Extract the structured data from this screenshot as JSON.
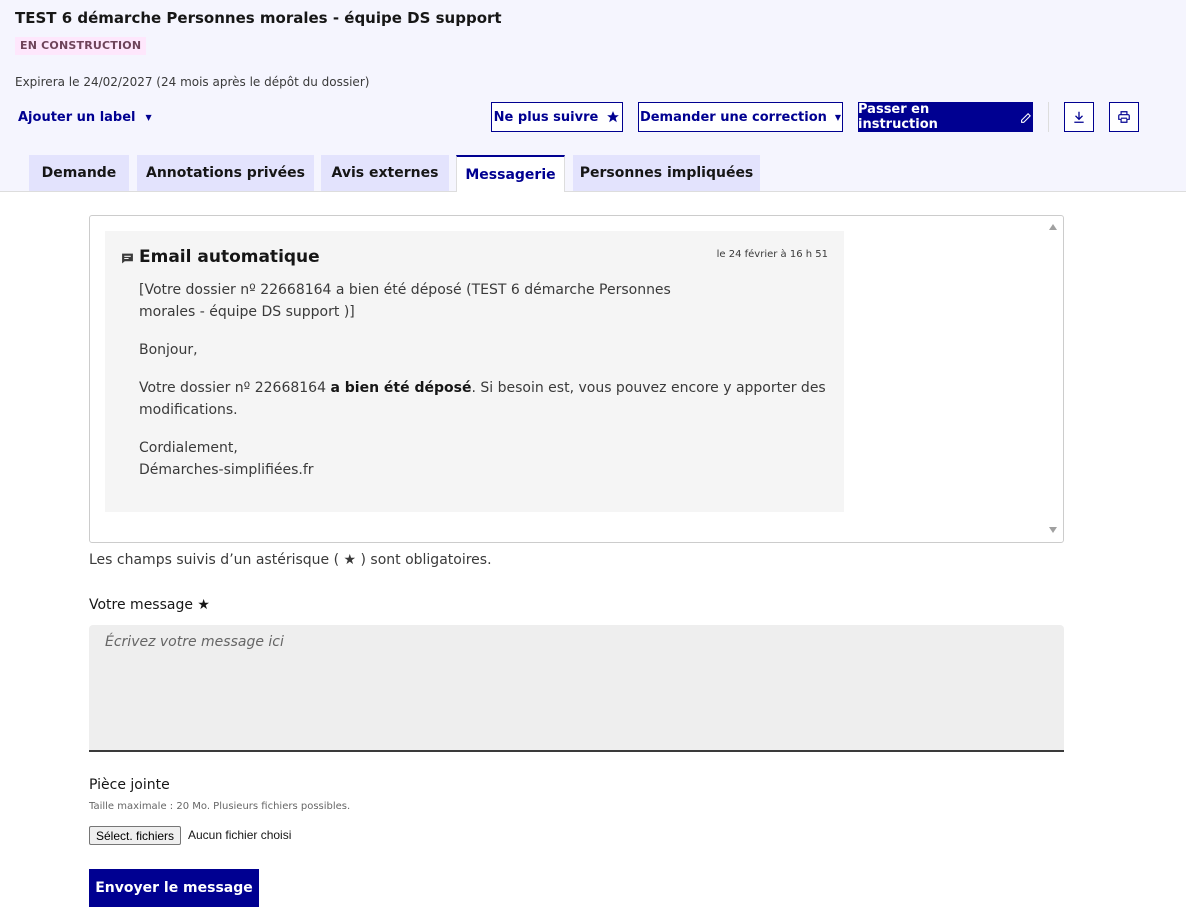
{
  "header": {
    "title": "TEST 6 démarche Personnes morales - équipe DS support",
    "status_badge": "EN CONSTRUCTION",
    "expiration": "Expirera le 24/02/2027 (24 mois après le dépôt du dossier)",
    "add_label": "Ajouter un label",
    "actions": {
      "unfollow": "Ne plus suivre",
      "request_correction": "Demander une correction",
      "pass_instruction": "Passer en instruction"
    }
  },
  "tabs": [
    {
      "label": "Demande",
      "active": false
    },
    {
      "label": "Annotations privées",
      "active": false
    },
    {
      "label": "Avis externes",
      "active": false
    },
    {
      "label": "Messagerie",
      "active": true
    },
    {
      "label": "Personnes impliquées",
      "active": false
    }
  ],
  "message": {
    "sender": "Email automatique",
    "date": "le 24 février à 16 h 51",
    "subject": "[Votre dossier nº 22668164 a bien été déposé (TEST 6 démarche Personnes morales - équipe DS support )]",
    "greeting": "Bonjour,",
    "body_prefix": "Votre dossier nº 22668164 ",
    "body_bold": "a bien été déposé",
    "body_suffix": ". Si besoin est, vous pouvez encore y apporter des modifications.",
    "closing": "Cordialement,",
    "signature": "Démarches-simplifiées.fr"
  },
  "form": {
    "required_note": "Les champs suivis d’un astérisque ( ★ ) sont obligatoires.",
    "message_label": "Votre message ★",
    "message_placeholder": "Écrivez votre message ici",
    "attachment_label": "Pièce jointe",
    "attachment_hint": "Taille maximale : 20 Mo. Plusieurs fichiers possibles.",
    "file_button": "Sélect. fichiers",
    "file_status": "Aucun fichier choisi",
    "submit": "Envoyer le message"
  },
  "colors": {
    "primary": "#000091",
    "header_bg": "#f5f5fe",
    "badge_bg": "#fee7fc",
    "tab_bg": "#e3e3fd"
  }
}
